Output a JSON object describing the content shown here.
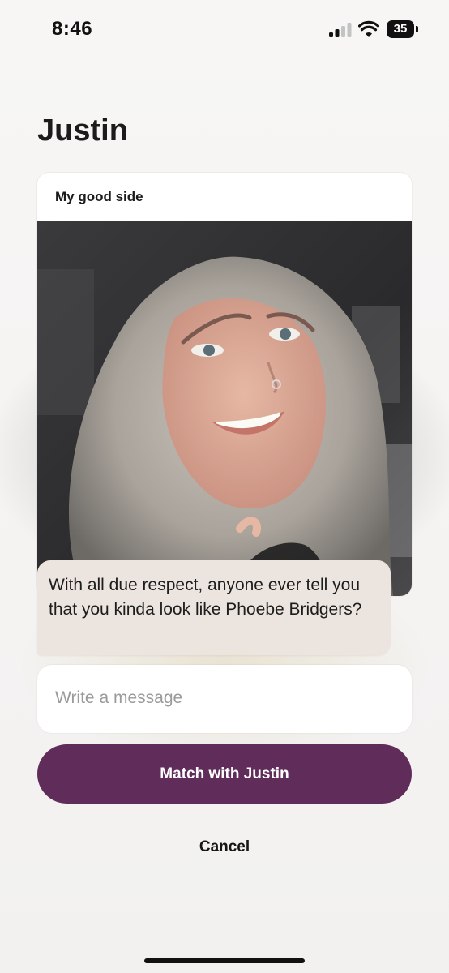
{
  "status_bar": {
    "time": "8:46",
    "battery_level": "35",
    "icons": [
      "cellular-signal-icon",
      "wifi-icon",
      "battery-icon"
    ]
  },
  "profile": {
    "name": "Justin"
  },
  "prompt_card": {
    "title": "My good side",
    "photo_description_icon": "profile-photo"
  },
  "comment": {
    "text": "With all due respect, anyone ever tell you that you kinda look like Phoebe Bridgers?"
  },
  "message_input": {
    "placeholder": "Write a message",
    "value": ""
  },
  "actions": {
    "match_label": "Match with Justin",
    "cancel_label": "Cancel"
  },
  "colors": {
    "accent": "#602d5b",
    "bubble": "#ebe4df",
    "background": "#f4f3f2"
  }
}
